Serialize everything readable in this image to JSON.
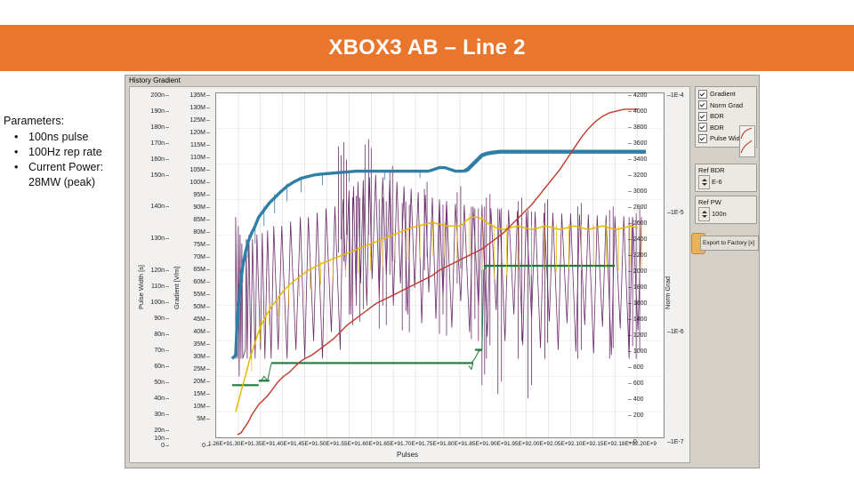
{
  "title": "XBOX3 AB – Line 2",
  "parameters": {
    "heading": "Parameters:",
    "items": [
      "100ns pulse",
      "100Hz rep rate",
      "Current Power: 28MW (peak)"
    ]
  },
  "window": {
    "titlebar": "History Gradient"
  },
  "panel": {
    "checkboxes": [
      {
        "label": "Gradient",
        "checked": true
      },
      {
        "label": "Norm Grad",
        "checked": true
      },
      {
        "label": "BDR",
        "checked": true
      },
      {
        "label": "BDR",
        "checked": true
      },
      {
        "label": "Pulse Width",
        "checked": true
      }
    ],
    "ref_bdr_label": "Ref BDR",
    "ref_bdr_value": "E-6",
    "ref_pw_label": "Ref PW",
    "ref_pw_value": "100n",
    "export_label": "Export to Factory [x]"
  },
  "chart_data": {
    "type": "line",
    "title": "History Gradient",
    "xlabel": "Pulses",
    "xlim": [
      1260000000.0,
      2200000000.0
    ],
    "xticks": [
      "1.26E+9",
      "1.30E+9",
      "1.35E+9",
      "1.40E+9",
      "1.45E+9",
      "1.50E+9",
      "1.55E+9",
      "1.60E+9",
      "1.65E+9",
      "1.70E+9",
      "1.75E+9",
      "1.80E+9",
      "1.85E+9",
      "1.90E+9",
      "1.95E+9",
      "2.00E+9",
      "2.05E+9",
      "2.10E+9",
      "2.15E+9",
      "2.18E+9",
      "2.20E+9"
    ],
    "axes": [
      {
        "name": "Pulse Width",
        "unit": "s",
        "ylabel": "Pulse Width [s]",
        "position": "left-outer",
        "ticks": [
          "200n",
          "190n",
          "180n",
          "170n",
          "160n",
          "150n",
          "140n",
          "130n",
          "120n",
          "110n",
          "100n",
          "90n",
          "80n",
          "70n",
          "60n",
          "50n",
          "40n",
          "30n",
          "20n",
          "10n",
          "0"
        ]
      },
      {
        "name": "Gradient",
        "unit": "V/m",
        "ylabel": "Gradient [V/m]",
        "position": "left-inner",
        "ticks": [
          "135M",
          "130M",
          "125M",
          "120M",
          "115M",
          "110M",
          "105M",
          "100M",
          "95M",
          "90M",
          "85M",
          "80M",
          "75M",
          "70M",
          "65M",
          "60M",
          "55M",
          "50M",
          "45M",
          "40M",
          "35M",
          "30M",
          "25M",
          "20M",
          "15M",
          "10M",
          "5M",
          "0"
        ]
      },
      {
        "name": "BDR",
        "ylabel": "BDR",
        "position": "right-outer",
        "ticks": [
          "-1E-4",
          "-1E-5",
          "-1E-6",
          "-1E-7"
        ]
      },
      {
        "name": "Norm Grad",
        "ylabel": "Norm Grad",
        "position": "right-inner",
        "ticks": [
          "4200",
          "4000",
          "3800",
          "3600",
          "3400",
          "3200",
          "3000",
          "2800",
          "2600",
          "2400",
          "2200",
          "2000",
          "1800",
          "1600",
          "1400",
          "1200",
          "1000",
          "800",
          "600",
          "400",
          "200",
          "0"
        ]
      }
    ],
    "series": [
      {
        "name": "Gradient",
        "color": "#2E7EA6",
        "description": "Blue trace rising from ~45M at 1.28E9, plateau ~112M from 1.45E9 onward, step up to ~118M after 1.90E9",
        "x": [
          1280000000.0,
          1300000000.0,
          1330000000.0,
          1360000000.0,
          1400000000.0,
          1450000000.0,
          1500000000.0,
          1600000000.0,
          1700000000.0,
          1800000000.0,
          1860000000.0,
          1900000000.0,
          2000000000.0,
          2100000000.0,
          2180000000.0
        ],
        "y_units": "V/m",
        "y": [
          30000000,
          52000000,
          78000000,
          95000000,
          105000000,
          110000000,
          111000000,
          112000000,
          112000000,
          113000000,
          113000000,
          118000000,
          118000000,
          118000000,
          118000000
        ]
      },
      {
        "name": "Norm Grad",
        "color": "#E8B800",
        "description": "Yellow/gold trace, noisy, rising from ~600 to ~2600 then scattered plateau near 2400-2900",
        "x": [
          1280000000.0,
          1320000000.0,
          1380000000.0,
          1450000000.0,
          1520000000.0,
          1600000000.0,
          1700000000.0,
          1800000000.0,
          1900000000.0,
          2000000000.0,
          2100000000.0,
          2180000000.0
        ],
        "y_units": "Norm Grad",
        "y": [
          500,
          900,
          1500,
          1900,
          2150,
          2250,
          2400,
          2500,
          2600,
          2620,
          2700,
          2750
        ]
      },
      {
        "name": "BDR",
        "color": "#C0392B",
        "description": "Red trace climbing from ~2E-7 at 1.30E9 to ~1E-4 near 2.15E9",
        "x": [
          1300000000.0,
          1400000000.0,
          1500000000.0,
          1600000000.0,
          1700000000.0,
          1800000000.0,
          1900000000.0,
          2000000000.0,
          2080000000.0,
          2150000000.0
        ],
        "y_units": "BDR",
        "y": [
          2e-07,
          4e-07,
          8e-07,
          2e-06,
          5e-06,
          1.2e-05,
          3e-05,
          6e-05,
          9e-05,
          0.0001
        ]
      },
      {
        "name": "BDR-2",
        "color": "#1E7A3C",
        "description": "Dark green flat segments: ~45n level from 1.30E9-1.40E9, ~52n level 1.42E9-1.70E9, ~95n level 1.78E9-2.12E9",
        "x": [
          1300000000.0,
          1400000000.0,
          1420000000.0,
          1700000000.0,
          1780000000.0,
          2120000000.0
        ],
        "y_units": "s",
        "y": [
          4e-08,
          4e-08,
          5.2e-08,
          5.2e-08,
          9.5e-08,
          9.5e-08
        ]
      },
      {
        "name": "Pulse Width",
        "color": "#6B2D6B",
        "description": "Purple spiky trace with deep vertical breakdown spikes across the full range, typically 95n-135n with drops toward 20n",
        "x": [
          1310000000.0,
          1400000000.0,
          1500000000.0,
          1600000000.0,
          1700000000.0,
          1800000000.0,
          1900000000.0,
          2000000000.0,
          2100000000.0,
          2180000000.0
        ],
        "y_units": "s",
        "y": [
          1e-07,
          1.05e-07,
          1.1e-07,
          1.15e-07,
          1.2e-07,
          1.2e-07,
          1.25e-07,
          1.2e-07,
          1.2e-07,
          1.15e-07
        ]
      }
    ]
  }
}
